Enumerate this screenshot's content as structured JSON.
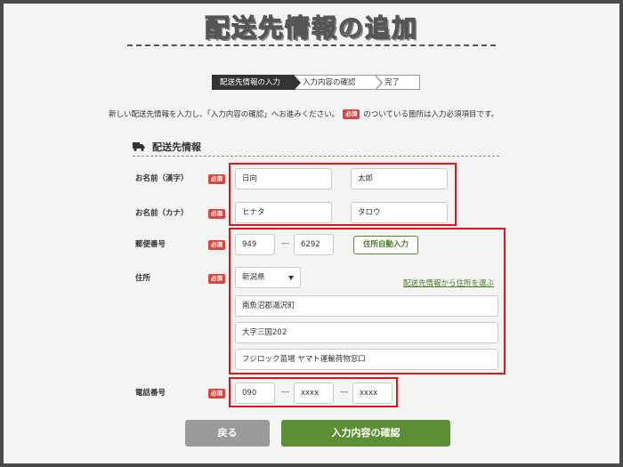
{
  "page_title": "配送先情報の追加",
  "steps": [
    {
      "label": "配送先情報の入力",
      "active": true
    },
    {
      "label": "入力内容の確認",
      "active": false
    },
    {
      "label": "完了",
      "active": false
    }
  ],
  "intro": {
    "before": "新しい配送先情報を入力し、「入力内容の確認」へお進みください。",
    "badge": "必須",
    "after": "のついている箇所は入力必須項目です。"
  },
  "section_title": "配送先情報",
  "required_badge": "必須",
  "fields": {
    "name_kanji": {
      "label": "お名前（漢字）",
      "last": "日向",
      "first": "太郎"
    },
    "name_kana": {
      "label": "お名前（カナ）",
      "last": "ヒナタ",
      "first": "タロウ"
    },
    "postal": {
      "label": "郵便番号",
      "part1": "949",
      "part2": "6292",
      "auto_button": "住所自動入力"
    },
    "address": {
      "label": "住所",
      "prefecture": "新潟県",
      "link": "配送先情報から住所を選ぶ",
      "line1": "南魚沼郡湯沢町",
      "line2": "大字三国202",
      "line3": "フジロック苗場 ヤマト運輸荷物窓口"
    },
    "phone": {
      "label": "電話番号",
      "part1": "090",
      "part2": "xxxx",
      "part3": "xxxx"
    }
  },
  "separator": "―",
  "buttons": {
    "back": "戻る",
    "confirm": "入力内容の確認"
  },
  "colors": {
    "accent_green": "#5c8f33",
    "required_red": "#d9463f",
    "highlight_red": "#e0141b"
  }
}
